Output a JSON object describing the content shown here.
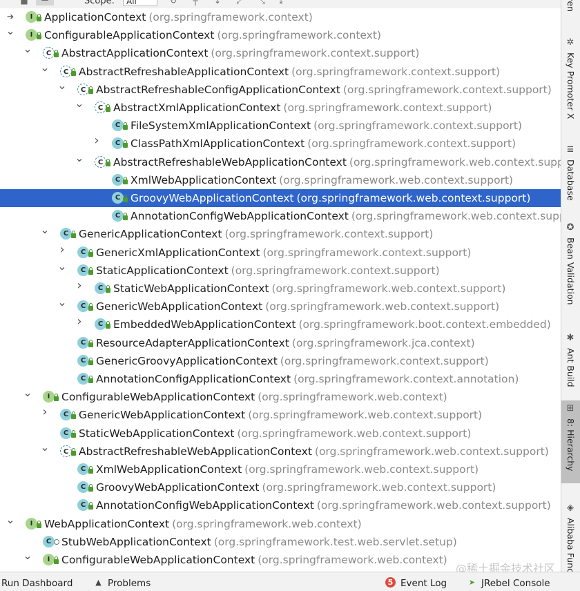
{
  "toolbar": {
    "scope_label": "Scope:",
    "scope_value": "All"
  },
  "tree": [
    {
      "depth": 0,
      "arrow": "none",
      "kind": "interface",
      "locked": true,
      "name": "ApplicationContext",
      "pkg": "(org.springframework.context)",
      "selected": false,
      "root_marker": true
    },
    {
      "depth": 0,
      "arrow": "expanded",
      "kind": "interface",
      "locked": true,
      "name": "ConfigurableApplicationContext",
      "pkg": "(org.springframework.context)",
      "selected": false
    },
    {
      "depth": 1,
      "arrow": "expanded",
      "kind": "abstract",
      "locked": true,
      "name": "AbstractApplicationContext",
      "pkg": "(org.springframework.context.support)",
      "selected": false
    },
    {
      "depth": 2,
      "arrow": "expanded",
      "kind": "abstract",
      "locked": true,
      "name": "AbstractRefreshableApplicationContext",
      "pkg": "(org.springframework.context.support)",
      "selected": false
    },
    {
      "depth": 3,
      "arrow": "expanded",
      "kind": "abstract",
      "locked": true,
      "name": "AbstractRefreshableConfigApplicationContext",
      "pkg": "(org.springframework.context.support)",
      "selected": false
    },
    {
      "depth": 4,
      "arrow": "expanded",
      "kind": "abstract",
      "locked": true,
      "name": "AbstractXmlApplicationContext",
      "pkg": "(org.springframework.context.support)",
      "selected": false
    },
    {
      "depth": 5,
      "arrow": "none",
      "kind": "class",
      "locked": true,
      "name": "FileSystemXmlApplicationContext",
      "pkg": "(org.springframework.context.support)",
      "selected": false
    },
    {
      "depth": 5,
      "arrow": "collapsed",
      "kind": "class",
      "locked": true,
      "name": "ClassPathXmlApplicationContext",
      "pkg": "(org.springframework.context.support)",
      "selected": false
    },
    {
      "depth": 4,
      "arrow": "expanded",
      "kind": "abstract",
      "locked": true,
      "name": "AbstractRefreshableWebApplicationContext",
      "pkg": "(org.springframework.web.context.suppo",
      "selected": false
    },
    {
      "depth": 5,
      "arrow": "none",
      "kind": "class",
      "locked": true,
      "name": "XmlWebApplicationContext",
      "pkg": "(org.springframework.web.context.support)",
      "selected": false
    },
    {
      "depth": 5,
      "arrow": "none",
      "kind": "class",
      "locked": true,
      "name": "GroovyWebApplicationContext",
      "pkg": "(org.springframework.web.context.support)",
      "selected": true
    },
    {
      "depth": 5,
      "arrow": "none",
      "kind": "class",
      "locked": true,
      "name": "AnnotationConfigWebApplicationContext",
      "pkg": "(org.springframework.web.context.suppo",
      "selected": false
    },
    {
      "depth": 2,
      "arrow": "expanded",
      "kind": "class",
      "locked": true,
      "name": "GenericApplicationContext",
      "pkg": "(org.springframework.context.support)",
      "selected": false
    },
    {
      "depth": 3,
      "arrow": "collapsed",
      "kind": "class",
      "locked": true,
      "name": "GenericXmlApplicationContext",
      "pkg": "(org.springframework.context.support)",
      "selected": false
    },
    {
      "depth": 3,
      "arrow": "expanded",
      "kind": "class",
      "locked": true,
      "name": "StaticApplicationContext",
      "pkg": "(org.springframework.context.support)",
      "selected": false
    },
    {
      "depth": 4,
      "arrow": "collapsed",
      "kind": "class",
      "locked": true,
      "name": "StaticWebApplicationContext",
      "pkg": "(org.springframework.web.context.support)",
      "selected": false
    },
    {
      "depth": 3,
      "arrow": "expanded",
      "kind": "class",
      "locked": true,
      "name": "GenericWebApplicationContext",
      "pkg": "(org.springframework.web.context.support)",
      "selected": false
    },
    {
      "depth": 4,
      "arrow": "collapsed",
      "kind": "class",
      "locked": true,
      "name": "EmbeddedWebApplicationContext",
      "pkg": "(org.springframework.boot.context.embedded)",
      "selected": false
    },
    {
      "depth": 3,
      "arrow": "none",
      "kind": "class",
      "locked": true,
      "name": "ResourceAdapterApplicationContext",
      "pkg": "(org.springframework.jca.context)",
      "selected": false
    },
    {
      "depth": 3,
      "arrow": "none",
      "kind": "class",
      "locked": true,
      "name": "GenericGroovyApplicationContext",
      "pkg": "(org.springframework.context.support)",
      "selected": false
    },
    {
      "depth": 3,
      "arrow": "none",
      "kind": "class",
      "locked": true,
      "name": "AnnotationConfigApplicationContext",
      "pkg": "(org.springframework.context.annotation)",
      "selected": false
    },
    {
      "depth": 1,
      "arrow": "expanded",
      "kind": "interface",
      "locked": true,
      "name": "ConfigurableWebApplicationContext",
      "pkg": "(org.springframework.web.context)",
      "selected": false
    },
    {
      "depth": 2,
      "arrow": "collapsed",
      "kind": "class",
      "locked": true,
      "name": "GenericWebApplicationContext",
      "pkg": "(org.springframework.web.context.support)",
      "selected": false
    },
    {
      "depth": 2,
      "arrow": "none",
      "kind": "class",
      "locked": true,
      "name": "StaticWebApplicationContext",
      "pkg": "(org.springframework.web.context.support)",
      "selected": false
    },
    {
      "depth": 2,
      "arrow": "expanded",
      "kind": "abstract",
      "locked": true,
      "name": "AbstractRefreshableWebApplicationContext",
      "pkg": "(org.springframework.web.context.support)",
      "selected": false
    },
    {
      "depth": 3,
      "arrow": "none",
      "kind": "class",
      "locked": true,
      "name": "XmlWebApplicationContext",
      "pkg": "(org.springframework.web.context.support)",
      "selected": false
    },
    {
      "depth": 3,
      "arrow": "none",
      "kind": "class",
      "locked": true,
      "name": "GroovyWebApplicationContext",
      "pkg": "(org.springframework.web.context.support)",
      "selected": false
    },
    {
      "depth": 3,
      "arrow": "none",
      "kind": "class",
      "locked": true,
      "name": "AnnotationConfigWebApplicationContext",
      "pkg": "(org.springframework.web.context.support)",
      "selected": false
    },
    {
      "depth": 0,
      "arrow": "expanded",
      "kind": "interface",
      "locked": true,
      "name": "WebApplicationContext",
      "pkg": "(org.springframework.web.context)",
      "selected": false
    },
    {
      "depth": 1,
      "arrow": "none",
      "kind": "class",
      "locked": false,
      "stub": true,
      "name": "StubWebApplicationContext",
      "pkg": "(org.springframework.test.web.servlet.setup)",
      "selected": false
    },
    {
      "depth": 1,
      "arrow": "expanded",
      "kind": "interface",
      "locked": true,
      "name": "ConfigurableWebApplicationContext",
      "pkg": "(org.springframework.web.context)",
      "selected": false
    }
  ],
  "side_tabs": [
    {
      "label": "ven",
      "icon": "maven-icon",
      "glyph": "",
      "active": false
    },
    {
      "label": "Key Promoter X",
      "icon": "key-promoter-icon",
      "glyph": "✲",
      "active": false
    },
    {
      "label": "Database",
      "icon": "database-icon",
      "glyph": "≣",
      "active": false
    },
    {
      "label": "Bean Validation",
      "icon": "bean-validation-icon",
      "glyph": "✪",
      "active": false
    },
    {
      "label": "Ant Build",
      "icon": "ant-icon",
      "glyph": "✱",
      "active": false
    },
    {
      "label": "8: Hierarchy",
      "icon": "hierarchy-icon",
      "glyph": "⊞",
      "active": true
    },
    {
      "label": "Alibaba Func",
      "icon": "alibaba-icon",
      "glyph": "◈",
      "active": false
    }
  ],
  "statusbar": {
    "run_dashboard": "Run Dashboard",
    "problems": "Problems",
    "event_log_count": "5",
    "event_log": "Event Log",
    "jrebel": "JRebel Console"
  },
  "watermark": "@稀土掘金技术社区",
  "colors": {
    "selection": "#2f65ca",
    "interface_icon": "#a8d48c",
    "class_icon": "#8fd0dc",
    "lock": "#4f9a2d",
    "event_badge": "#e04a3c"
  }
}
